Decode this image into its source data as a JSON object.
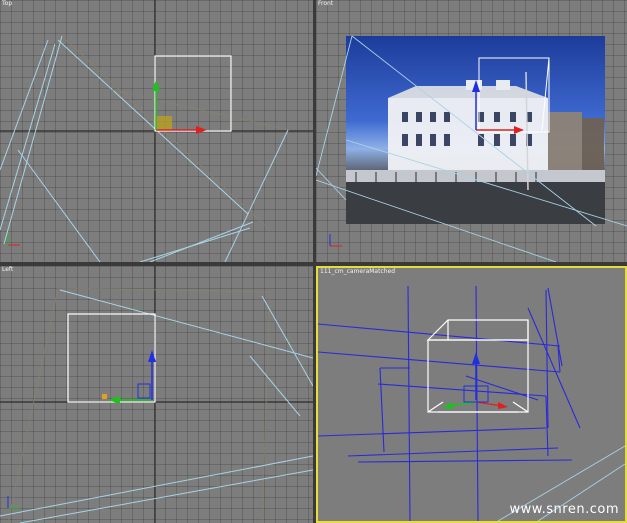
{
  "viewports": {
    "top": {
      "label": "Top"
    },
    "front": {
      "label": "Front"
    },
    "left": {
      "label": "Left"
    },
    "camera": {
      "label": "111_cm_cameraMatched"
    }
  },
  "colors": {
    "viewport_bg": "#7d7d7d",
    "grid_line": "#5f5f5f",
    "active_border": "#e6dc3a",
    "x_axis": "#e02020",
    "y_axis": "#20c020",
    "z_axis": "#2030e0",
    "camera_lines": "#2a2ad8",
    "helper_lines": "#a9d3e6"
  },
  "watermark": "www.snren.com"
}
